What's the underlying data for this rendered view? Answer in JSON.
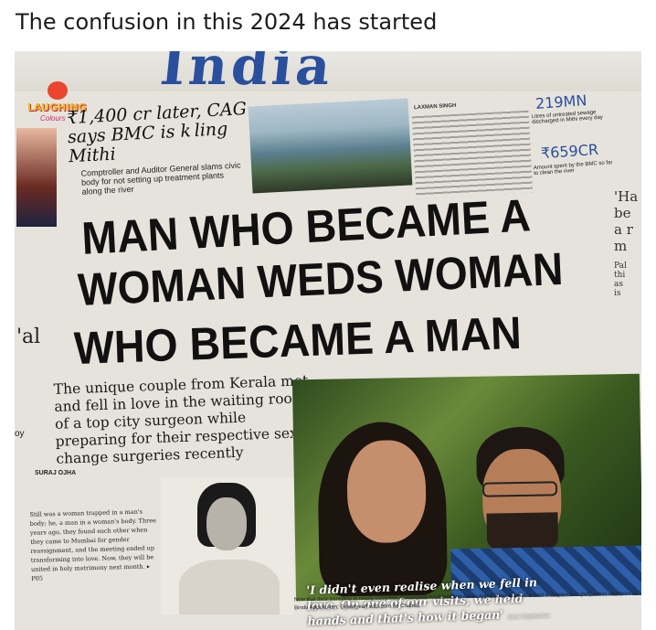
{
  "post": {
    "caption": "The confusion in this 2024 has started"
  },
  "newspaper": {
    "logo": {
      "text": "LAUGHING",
      "sub": "Colours"
    },
    "top_story": {
      "headline": "₹1,400 cr later, CAG says BMC is k ling Mithi",
      "subhead": "Comptroller and Auditor General slams civic body for not setting up treatment plants along the river",
      "byline": "LAXMAN SINGH",
      "stat1_value": "219MN",
      "stat1_note": "Litres of untreated sewage discharged in Mithi every day",
      "stat2_value": "₹659CR",
      "stat2_note": "Amount spent by the BMC so far to clean the river"
    },
    "headline_lines": [
      "MAN WHO BECAME A",
      "WOMAN WEDS WOMAN",
      "WHO BECAME A MAN"
    ],
    "deck": "The unique couple from Kerala met and fell in love in the waiting room of a top city surgeon while preparing for their respective sex-change surgeries recently",
    "reporter": "SURAJ OJHA",
    "body_text": "Still was a woman trapped in a man's body; he, a man in a woman's body. Three years ago, they found each other when they came to Mumbai for gender reassignment, and the meeting ended up transforming into love. Now, they will be united in holy matrimony next month. ▸ P05",
    "quote": "'I didn't even realise when we fell in love. On one of our visits, we held hands and that's how it began'",
    "quote_attr": "Aarav Appukuttan",
    "photo_caption": "Now that their transition is nearly complete, Sukanyeah Krishnan and Aarav Appukuttan will tie the knot in September. (left) Aarav was born as Bindu Appukuttan; Sukanyeah was born as Chandu",
    "right_fragments": [
      "'Ha",
      "be",
      "a r",
      "m",
      "Pal",
      "thi",
      "as",
      "is"
    ],
    "left_fragments": [
      "'al",
      "oy"
    ]
  }
}
